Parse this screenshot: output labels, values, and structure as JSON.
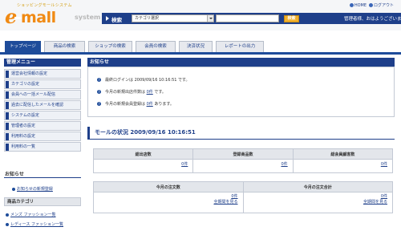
{
  "header": {
    "logo_tagline": "ショッピングモールシステム",
    "logo_e": "e",
    "logo_word": "mall",
    "logo_system": "system",
    "search_label": "検索",
    "search_select_value": "カテゴリ選択",
    "search_input_value": "",
    "search_button": "検索",
    "greeting": "管理者様、おはようございます。",
    "link_home": "HOME",
    "link_logout": "ログアウト"
  },
  "tabs": [
    {
      "label": "トップページ"
    },
    {
      "label": "商品の検索"
    },
    {
      "label": "ショップの検索"
    },
    {
      "label": "会員の検索"
    },
    {
      "label": "決済状況"
    },
    {
      "label": "レポートの出力"
    }
  ],
  "sidebar": {
    "menu_title": "管理メニュー",
    "menu_items": [
      {
        "label": "運営会社情報の設定"
      },
      {
        "label": "カテゴリの設定"
      },
      {
        "label": "会員への一括メール配信"
      },
      {
        "label": "過去に配信したメールを確認"
      },
      {
        "label": "システムの設定"
      },
      {
        "label": "管理者の設定"
      },
      {
        "label": "利用料の設定"
      },
      {
        "label": "利用料の一覧"
      }
    ],
    "notice_title": "お知らせ",
    "notice_link": "お知らせの新規登録",
    "category_title": "商品カテゴリ",
    "category_items": [
      {
        "label": "メンズ ファッション一覧"
      },
      {
        "label": "レディース ファッション一覧"
      }
    ]
  },
  "notices": {
    "title": "お知らせ",
    "last_login_label": "最終ログインは 2009/09/16 10:16:51 です。",
    "new_shops_prefix": "今月の新規出店件数は ",
    "new_shops_count": "0件",
    "new_shops_suffix": " です。",
    "new_members_prefix": "今月の新規会員登録は ",
    "new_members_count": "0件",
    "new_members_suffix": " あります。"
  },
  "mall_status": {
    "title": "モールの状況 2009/09/16 10:16:51",
    "table1": {
      "headers": [
        "総出店数",
        "登録商品数",
        "総会員顧客数"
      ],
      "values": [
        "0件",
        "0件",
        "0件"
      ]
    },
    "table2": {
      "headers": [
        "今月の注文数",
        "今月の注文合計"
      ],
      "values": [
        "0件",
        "0件"
      ],
      "detail_link": "全期間を見る"
    }
  },
  "colors": {
    "brand": "#f08a14",
    "navy": "#1e3f8a",
    "accent_button": "#f2b02c"
  }
}
